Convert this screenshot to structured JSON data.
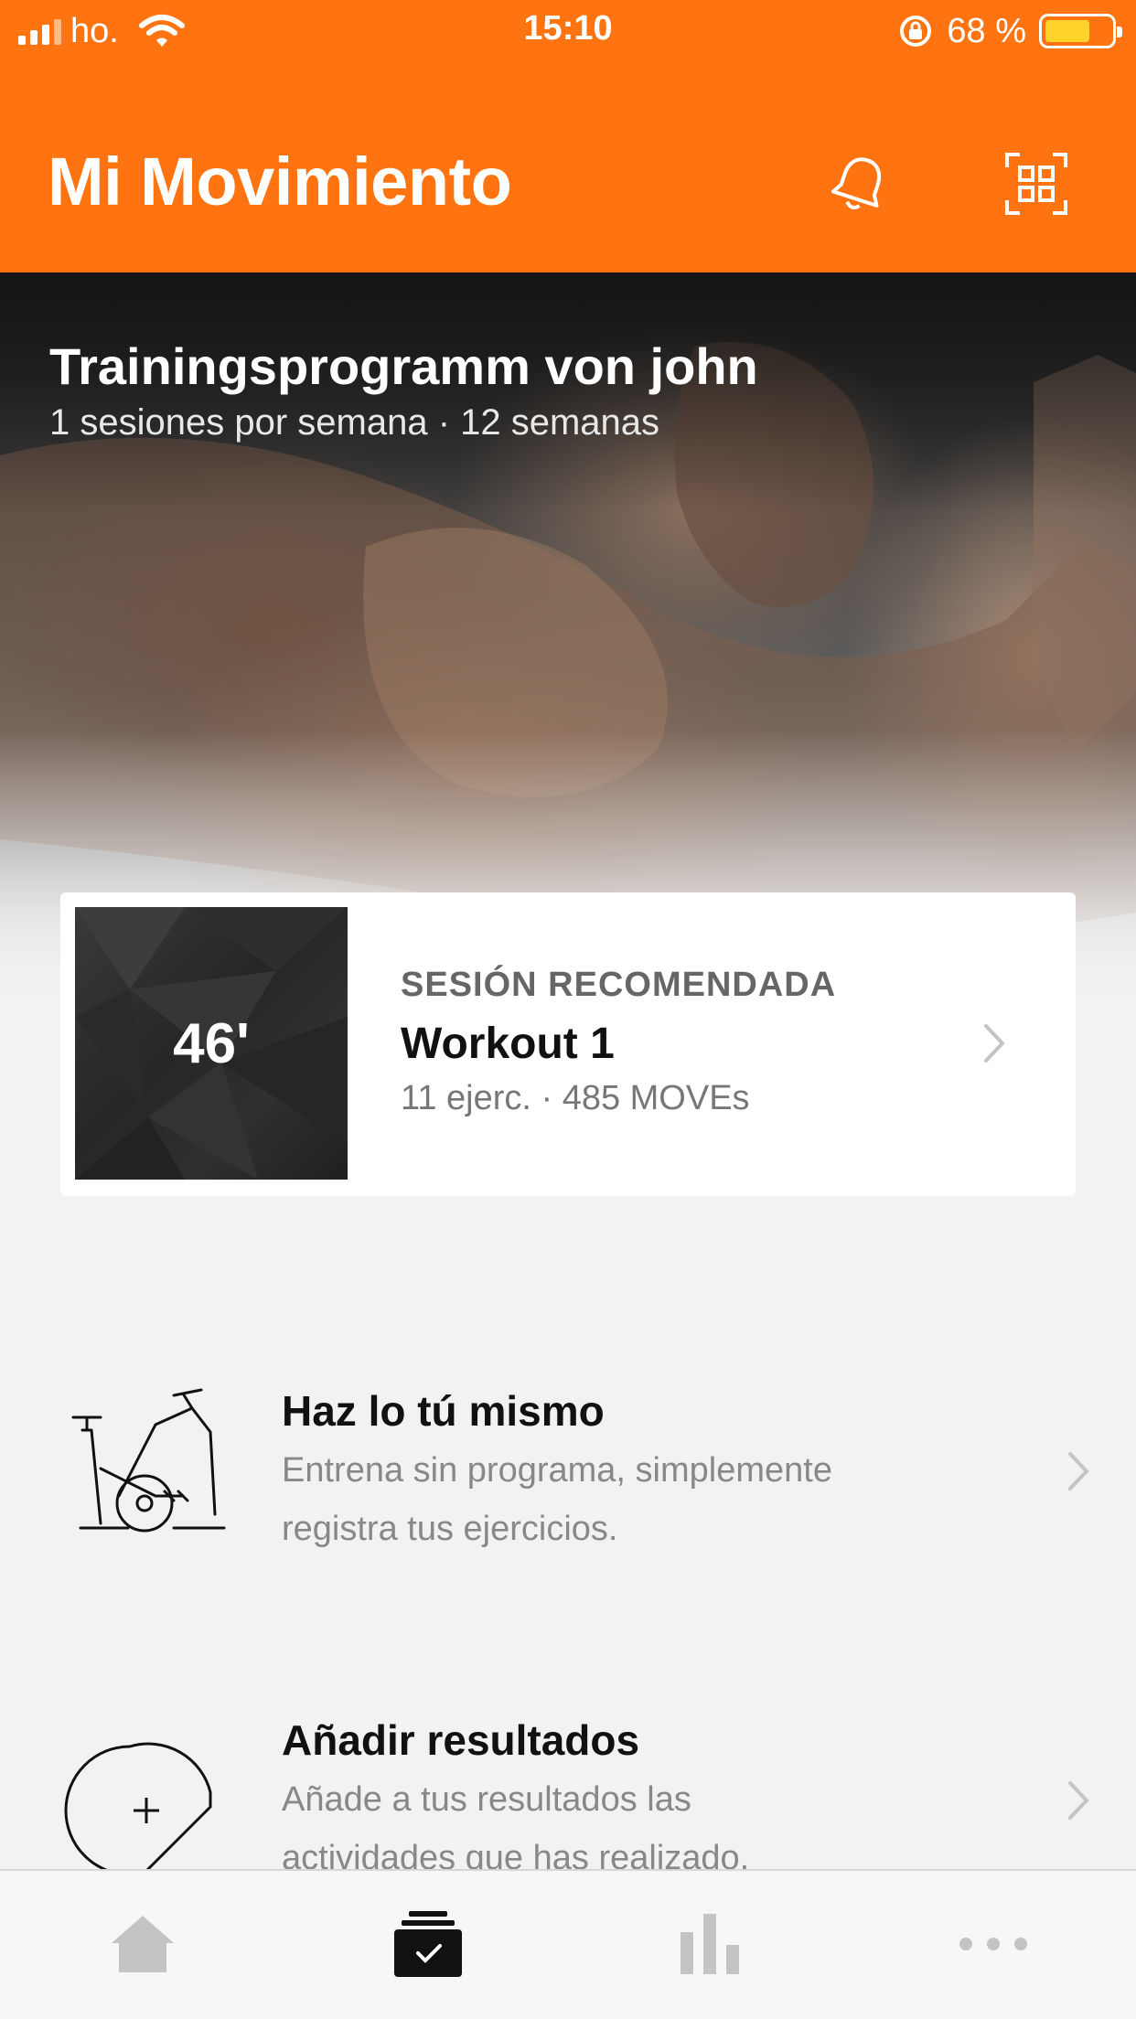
{
  "status_bar": {
    "carrier": "ho.",
    "time": "15:10",
    "battery_percent": "68 %",
    "battery_level": 0.68,
    "colors": {
      "battery_fill": "#ffd42a"
    }
  },
  "header": {
    "title": "Mi Movimiento",
    "icons": [
      "bell-icon",
      "qr-scan-icon"
    ],
    "colors": {
      "background": "#ff7310"
    }
  },
  "program": {
    "title": "Trainingsprogramm von john",
    "subtitle": "1 sesiones por semana · 12 semanas"
  },
  "recommended": {
    "label": "SESIÓN RECOMENDADA",
    "title": "Workout 1",
    "meta": "11 ejerc. · 485 MOVEs",
    "duration": "46'"
  },
  "items": [
    {
      "icon": "exercise-bike-icon",
      "title": "Haz lo tú mismo",
      "desc_line1": "Entrena sin programa, simplemente",
      "desc_line2": "registra tus ejercicios."
    },
    {
      "icon": "add-results-icon",
      "title": "Añadir resultados",
      "desc_line1": "Añade a tus resultados las",
      "desc_line2": "actividades que has realizado."
    }
  ],
  "tab_bar": {
    "tabs": [
      "home-icon",
      "workout-tab-icon",
      "stats-icon",
      "more-icon"
    ],
    "active": "workout-tab-icon"
  }
}
